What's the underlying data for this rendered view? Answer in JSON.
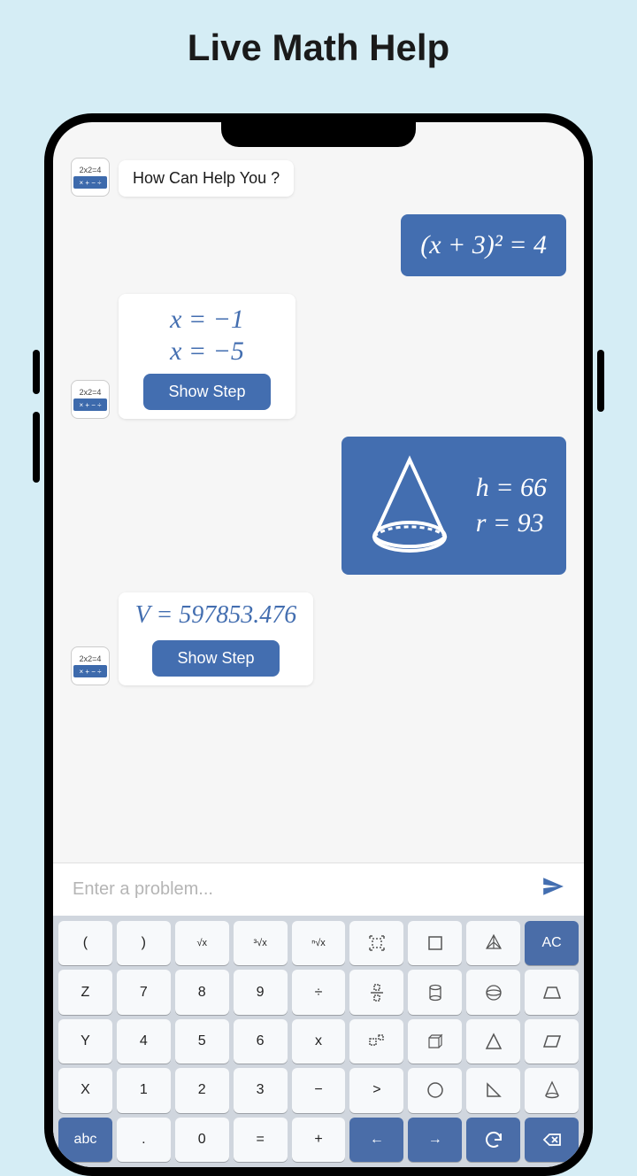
{
  "header": {
    "title": "Live Math Help"
  },
  "avatar": {
    "eq": "2x2=4",
    "ops": "× + − ÷"
  },
  "chat": {
    "greeting": "How Can Help You ?",
    "user_eq": "(x + 3)² = 4",
    "answer1_line1": "x = −1",
    "answer1_line2": "x = −5",
    "show_step": "Show Step",
    "cone_h": "h = 66",
    "cone_r": "r = 93",
    "volume": "V = 597853.476"
  },
  "input": {
    "placeholder": "Enter a problem..."
  },
  "keyboard": {
    "rows": [
      [
        {
          "l": "("
        },
        {
          "l": ")"
        },
        {
          "l": "√x",
          "sm": true
        },
        {
          "l": "³√x",
          "sm": true
        },
        {
          "l": "ⁿ√x",
          "sm": true
        },
        {
          "icon": "brackets"
        },
        {
          "icon": "square"
        },
        {
          "icon": "pyramid"
        },
        {
          "l": "AC",
          "accent": true
        }
      ],
      [
        {
          "l": "Z"
        },
        {
          "l": "7"
        },
        {
          "l": "8"
        },
        {
          "l": "9"
        },
        {
          "l": "÷"
        },
        {
          "icon": "fraction"
        },
        {
          "icon": "cylinder"
        },
        {
          "icon": "sphere"
        },
        {
          "icon": "trapezoid"
        }
      ],
      [
        {
          "l": "Y"
        },
        {
          "l": "4"
        },
        {
          "l": "5"
        },
        {
          "l": "6"
        },
        {
          "l": "x"
        },
        {
          "icon": "dotbox"
        },
        {
          "icon": "cube"
        },
        {
          "icon": "triangle"
        },
        {
          "icon": "parallelogram"
        }
      ],
      [
        {
          "l": "X"
        },
        {
          "l": "1"
        },
        {
          "l": "2"
        },
        {
          "l": "3"
        },
        {
          "l": "−"
        },
        {
          "l": ">"
        },
        {
          "icon": "circle"
        },
        {
          "icon": "righttri"
        },
        {
          "icon": "cone2"
        }
      ],
      [
        {
          "l": "abc",
          "accent": true
        },
        {
          "l": "."
        },
        {
          "l": "0"
        },
        {
          "l": "="
        },
        {
          "l": "+"
        },
        {
          "l": "←",
          "accent": true
        },
        {
          "l": "→",
          "accent": true
        },
        {
          "icon": "undo",
          "accent": true
        },
        {
          "icon": "backspace",
          "accent": true
        }
      ]
    ]
  }
}
